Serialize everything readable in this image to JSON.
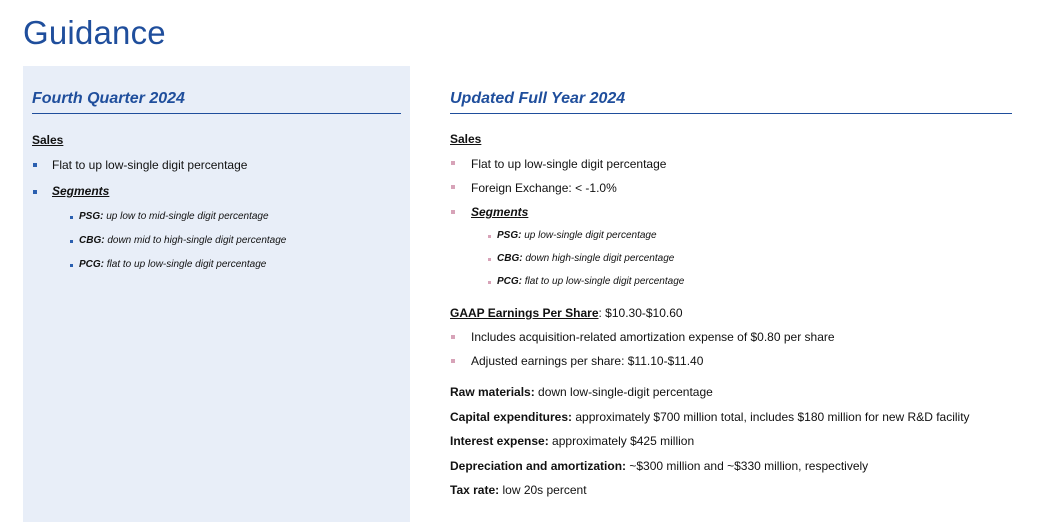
{
  "title": "Guidance",
  "colors": {
    "accent": "#1f4e9c",
    "panel": "#e8eef8",
    "bullet_blue": "#2a5fb0",
    "bullet_pink": "#d7a3b8"
  },
  "q4": {
    "heading": "Fourth Quarter 2024",
    "sales_label": "Sales",
    "sales_items": [
      "Flat to up low-single digit percentage"
    ],
    "segments_label": "Segments",
    "segments": [
      {
        "name": "PSG:",
        "text": " up low to mid-single digit percentage"
      },
      {
        "name": "CBG:",
        "text": " down mid to high-single digit percentage"
      },
      {
        "name": "PCG:",
        "text": " flat to up low-single digit percentage"
      }
    ]
  },
  "fy": {
    "heading": "Updated Full Year 2024",
    "sales_label": "Sales",
    "sales_items": [
      "Flat to up low-single digit percentage",
      "Foreign Exchange: < -1.0%"
    ],
    "segments_label": "Segments",
    "segments": [
      {
        "name": "PSG:",
        "text": " up low-single digit percentage"
      },
      {
        "name": "CBG:",
        "text": " down high-single digit percentage"
      },
      {
        "name": "PCG:",
        "text": " flat to up low-single digit percentage"
      }
    ],
    "eps_label": "GAAP Earnings Per Share",
    "eps_value": ": $10.30-$10.60",
    "eps_items": [
      "Includes acquisition-related amortization expense of $0.80 per share",
      "Adjusted earnings per share: $11.10-$11.40"
    ],
    "other": [
      {
        "label": "Raw materials:",
        "text": " down low-single-digit percentage"
      },
      {
        "label": "Capital expenditures:",
        "text": " approximately $700 million total, includes $180 million for new R&D facility"
      },
      {
        "label": "Interest expense:",
        "text": " approximately $425 million"
      },
      {
        "label": "Depreciation and amortization:",
        "text": " ~$300 million and ~$330 million, respectively"
      },
      {
        "label": "Tax rate:",
        "text": " low 20s percent"
      }
    ]
  }
}
